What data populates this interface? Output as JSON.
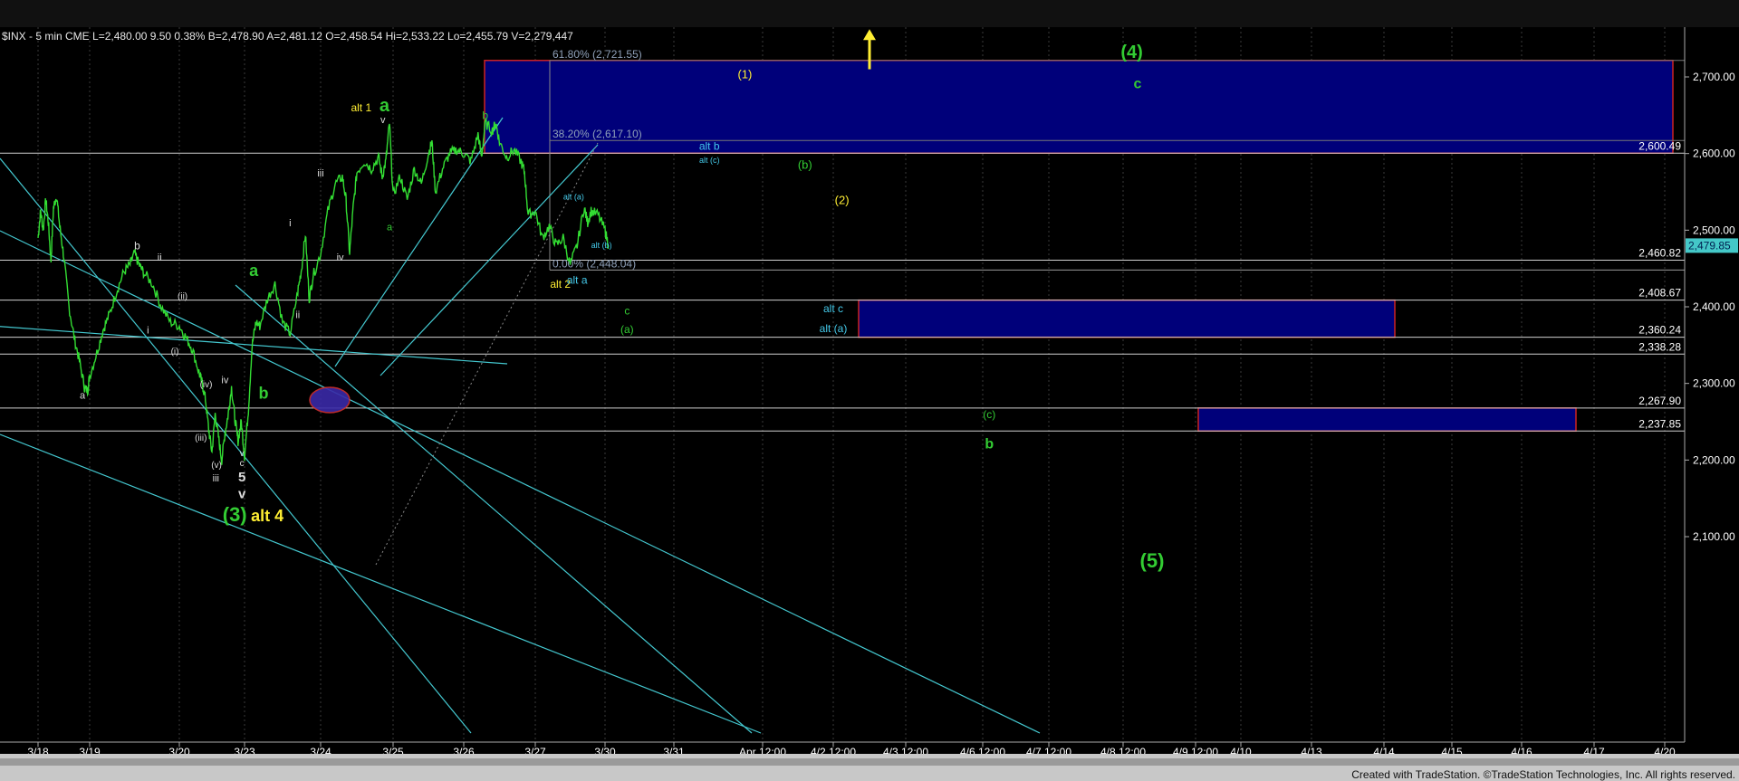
{
  "header": {
    "info_line": "$INX - 5 min  CME  L=2,480.00  9.50   0.38%  B=2,478.90  A=2,481.12  O=2,458.54  Hi=2,533.22  Lo=2,455.79  V=2,279,447"
  },
  "footer": {
    "credit": "Created with TradeStation. ©TradeStation Technologies, Inc. All rights reserved."
  },
  "colors": {
    "background": "#000000",
    "price": "#33dd33",
    "hline": "#d0d0d0",
    "channel": "#44c8d0",
    "zone_fill": "#00007a",
    "zone_border": "#cc2222",
    "green_label": "#33cc33",
    "yellow_label": "#ffee33",
    "blue_label": "#44c8e8",
    "white_label": "#dddddd",
    "last_price_bg": "#44c8c8"
  },
  "chart_data": {
    "type": "line",
    "symbol": "$INX",
    "interval": "5 min",
    "ylim": [
      2030,
      2770
    ],
    "yticks": [
      {
        "value": 2100,
        "label": "2,100.00"
      },
      {
        "value": 2200,
        "label": "2,200.00"
      },
      {
        "value": 2300,
        "label": "2,300.00"
      },
      {
        "value": 2400,
        "label": "2,400.00"
      },
      {
        "value": 2500,
        "label": "2,500.00"
      },
      {
        "value": 2600,
        "label": "2,600.00"
      },
      {
        "value": 2700,
        "label": "2,700.00"
      }
    ],
    "x_labels": [
      "3/18",
      "3/19",
      "3/20",
      "3/23",
      "3/24",
      "3/25",
      "3/26",
      "3/27",
      "3/30",
      "3/31",
      "Apr 12:00",
      "4/2 12:00",
      "4/3 12:00",
      "4/6 12:00",
      "4/7 12:00",
      "4/8 12:00",
      "4/9 12:00",
      "4/10",
      "4/13",
      "4/14",
      "4/15",
      "4/16",
      "4/17",
      "4/20"
    ],
    "level_lines": [
      {
        "value": 2600.49,
        "label": "2,600.49"
      },
      {
        "value": 2460.82,
        "label": "2,460.82"
      },
      {
        "value": 2408.67,
        "label": "2,408.67"
      },
      {
        "value": 2360.24,
        "label": "2,360.24"
      },
      {
        "value": 2338.28,
        "label": "2,338.28"
      },
      {
        "value": 2267.9,
        "label": "2,267.90"
      },
      {
        "value": 2237.85,
        "label": "2,237.85"
      }
    ],
    "last_price": {
      "value": 2479.85,
      "label": "2,479.85"
    },
    "fib_levels": [
      {
        "value": 2721.55,
        "label": "61.80% (2,721.55)"
      },
      {
        "value": 2617.1,
        "label": "38.20% (2,617.10)"
      },
      {
        "value": 2448.04,
        "label": "0.00% (2,448.04)"
      }
    ],
    "zones": [
      {
        "from_date": "3/26",
        "to_date": "4/20",
        "low": 2600.49,
        "high": 2721.55
      },
      {
        "from_date": "4/2",
        "to_date": "4/14",
        "low": 2360.24,
        "high": 2408.67
      },
      {
        "from_date": "4/9",
        "to_date": "4/16",
        "low": 2237.85,
        "high": 2267.9
      }
    ],
    "price_series": [
      [
        0,
        2490
      ],
      [
        0.05,
        2525
      ],
      [
        0.1,
        2500
      ],
      [
        0.15,
        2540
      ],
      [
        0.2,
        2510
      ],
      [
        0.25,
        2460
      ],
      [
        0.3,
        2530
      ],
      [
        0.36,
        2545
      ],
      [
        0.42,
        2505
      ],
      [
        0.5,
        2465
      ],
      [
        0.6,
        2400
      ],
      [
        0.7,
        2360
      ],
      [
        0.8,
        2330
      ],
      [
        0.9,
        2295
      ],
      [
        0.96,
        2290
      ],
      [
        1.0,
        2310
      ],
      [
        1.08,
        2340
      ],
      [
        1.15,
        2370
      ],
      [
        1.22,
        2390
      ],
      [
        1.3,
        2420
      ],
      [
        1.38,
        2445
      ],
      [
        1.45,
        2455
      ],
      [
        1.5,
        2470
      ],
      [
        1.55,
        2455
      ],
      [
        1.6,
        2445
      ],
      [
        1.7,
        2430
      ],
      [
        1.8,
        2400
      ],
      [
        1.9,
        2380
      ],
      [
        2.0,
        2375
      ],
      [
        2.1,
        2360
      ],
      [
        2.2,
        2345
      ],
      [
        2.3,
        2315
      ],
      [
        2.35,
        2300
      ],
      [
        2.4,
        2280
      ],
      [
        2.45,
        2240
      ],
      [
        2.5,
        2210
      ],
      [
        2.55,
        2260
      ],
      [
        2.6,
        2230
      ],
      [
        2.65,
        2200
      ],
      [
        2.7,
        2235
      ],
      [
        2.75,
        2260
      ],
      [
        2.8,
        2295
      ],
      [
        2.85,
        2255
      ],
      [
        2.9,
        2225
      ],
      [
        2.95,
        2250
      ],
      [
        3.0,
        2205
      ],
      [
        3.05,
        2265
      ],
      [
        3.1,
        2350
      ],
      [
        3.15,
        2380
      ],
      [
        3.2,
        2375
      ],
      [
        3.3,
        2410
      ],
      [
        3.4,
        2430
      ],
      [
        3.5,
        2380
      ],
      [
        3.6,
        2365
      ],
      [
        3.7,
        2420
      ],
      [
        3.75,
        2450
      ],
      [
        3.8,
        2495
      ],
      [
        3.85,
        2410
      ],
      [
        3.9,
        2440
      ],
      [
        4.0,
        2470
      ],
      [
        4.1,
        2525
      ],
      [
        4.2,
        2560
      ],
      [
        4.3,
        2570
      ],
      [
        4.35,
        2540
      ],
      [
        4.4,
        2470
      ],
      [
        4.45,
        2530
      ],
      [
        4.5,
        2575
      ],
      [
        4.6,
        2590
      ],
      [
        4.7,
        2580
      ],
      [
        4.8,
        2595
      ],
      [
        4.85,
        2570
      ],
      [
        4.9,
        2590
      ],
      [
        4.95,
        2640
      ],
      [
        5.0,
        2545
      ],
      [
        5.1,
        2570
      ],
      [
        5.2,
        2540
      ],
      [
        5.3,
        2580
      ],
      [
        5.4,
        2560
      ],
      [
        5.5,
        2600
      ],
      [
        5.55,
        2615
      ],
      [
        5.6,
        2550
      ],
      [
        5.7,
        2580
      ],
      [
        5.8,
        2600
      ],
      [
        5.9,
        2605
      ],
      [
        6.0,
        2600
      ],
      [
        6.1,
        2590
      ],
      [
        6.2,
        2625
      ],
      [
        6.25,
        2595
      ],
      [
        6.3,
        2640
      ],
      [
        6.4,
        2630
      ],
      [
        6.45,
        2640
      ],
      [
        6.5,
        2615
      ],
      [
        6.6,
        2595
      ],
      [
        6.7,
        2605
      ],
      [
        6.8,
        2590
      ],
      [
        6.85,
        2575
      ],
      [
        6.9,
        2520
      ],
      [
        7.0,
        2525
      ],
      [
        7.1,
        2490
      ],
      [
        7.2,
        2505
      ],
      [
        7.3,
        2480
      ],
      [
        7.4,
        2490
      ],
      [
        7.5,
        2455
      ],
      [
        7.6,
        2480
      ],
      [
        7.7,
        2530
      ],
      [
        7.75,
        2510
      ],
      [
        7.8,
        2525
      ],
      [
        7.9,
        2520
      ],
      [
        8.0,
        2500
      ],
      [
        8.05,
        2480
      ]
    ]
  },
  "annotations": {
    "green": [
      {
        "text": "a",
        "date_pos": 4.88,
        "value": 2655,
        "size": 20
      },
      {
        "text": "a",
        "date_pos": 3.12,
        "value": 2440,
        "size": 18
      },
      {
        "text": "b",
        "date_pos": 3.25,
        "value": 2280,
        "size": 18
      },
      {
        "text": "(3)",
        "date_pos": 2.85,
        "value": 2120,
        "size": 22
      },
      {
        "text": "(4)",
        "date_pos": 15.12,
        "value": 2725,
        "size": 20
      },
      {
        "text": "c",
        "date_pos": 15.2,
        "value": 2685,
        "size": 16
      },
      {
        "text": "(5)",
        "date_pos": 15.4,
        "value": 2060,
        "size": 22
      },
      {
        "text": "b",
        "date_pos": 13.1,
        "value": 2215,
        "size": 16
      },
      {
        "text": "b",
        "date_pos": 6.3,
        "value": 2645,
        "size": 12
      },
      {
        "text": "a",
        "date_pos": 4.95,
        "value": 2500,
        "size": 11
      },
      {
        "text": "(b)",
        "date_pos": 10.6,
        "value": 2580,
        "size": 13
      },
      {
        "text": "c",
        "date_pos": 8.32,
        "value": 2390,
        "size": 12
      },
      {
        "text": "(a)",
        "date_pos": 8.32,
        "value": 2366,
        "size": 12
      },
      {
        "text": "(c)",
        "date_pos": 13.1,
        "value": 2255,
        "size": 12
      }
    ],
    "yellow": [
      {
        "text": "alt 1",
        "date_pos": 4.56,
        "value": 2655,
        "size": 12
      },
      {
        "text": "alt 4",
        "date_pos": 3.3,
        "value": 2120,
        "size": 18
      },
      {
        "text": "alt 2",
        "date_pos": 7.36,
        "value": 2425,
        "size": 12
      },
      {
        "text": "(1)",
        "date_pos": 9.8,
        "value": 2698,
        "size": 13
      },
      {
        "text": "(2)",
        "date_pos": 11.12,
        "value": 2534,
        "size": 13
      }
    ],
    "blue": [
      {
        "text": "alt b",
        "date_pos": 9.4,
        "value": 2605,
        "size": 12
      },
      {
        "text": "alt (c)",
        "date_pos": 9.4,
        "value": 2588,
        "size": 9
      },
      {
        "text": "alt (a)",
        "date_pos": 7.55,
        "value": 2540,
        "size": 9
      },
      {
        "text": "alt (b)",
        "date_pos": 7.95,
        "value": 2477,
        "size": 9
      },
      {
        "text": "alt a",
        "date_pos": 7.6,
        "value": 2430,
        "size": 12
      },
      {
        "text": "alt c",
        "date_pos": 11.0,
        "value": 2393,
        "size": 12
      },
      {
        "text": "alt (a)",
        "date_pos": 11.0,
        "value": 2367,
        "size": 12
      }
    ],
    "white": [
      {
        "text": "b",
        "date_pos": 1.53,
        "value": 2475,
        "size": 12
      },
      {
        "text": "ii",
        "date_pos": 1.78,
        "value": 2460,
        "size": 11
      },
      {
        "text": "(ii)",
        "date_pos": 2.05,
        "value": 2410,
        "size": 10
      },
      {
        "text": "i",
        "date_pos": 1.65,
        "value": 2365,
        "size": 11
      },
      {
        "text": "(i)",
        "date_pos": 1.95,
        "value": 2338,
        "size": 10
      },
      {
        "text": "a",
        "date_pos": 0.86,
        "value": 2280,
        "size": 11
      },
      {
        "text": "(iv)",
        "date_pos": 2.41,
        "value": 2295,
        "size": 10
      },
      {
        "text": "iv",
        "date_pos": 2.7,
        "value": 2300,
        "size": 11
      },
      {
        "text": "(iii)",
        "date_pos": 2.33,
        "value": 2225,
        "size": 10
      },
      {
        "text": "(v)",
        "date_pos": 2.57,
        "value": 2190,
        "size": 10
      },
      {
        "text": "iii",
        "date_pos": 2.56,
        "value": 2172,
        "size": 11
      },
      {
        "text": "v",
        "date_pos": 2.96,
        "value": 2205,
        "size": 10
      },
      {
        "text": "c",
        "date_pos": 2.96,
        "value": 2192,
        "size": 10
      },
      {
        "text": "5",
        "date_pos": 2.96,
        "value": 2172,
        "size": 15
      },
      {
        "text": "v",
        "date_pos": 2.96,
        "value": 2150,
        "size": 15
      },
      {
        "text": "i",
        "date_pos": 3.6,
        "value": 2505,
        "size": 11
      },
      {
        "text": "ii",
        "date_pos": 3.7,
        "value": 2385,
        "size": 11
      },
      {
        "text": "iii",
        "date_pos": 4.0,
        "value": 2570,
        "size": 11
      },
      {
        "text": "iv",
        "date_pos": 4.27,
        "value": 2460,
        "size": 11
      },
      {
        "text": "v",
        "date_pos": 4.86,
        "value": 2640,
        "size": 11
      }
    ]
  },
  "arrow": {
    "date_pos": 11.5,
    "low": 2710,
    "high": 2760
  }
}
